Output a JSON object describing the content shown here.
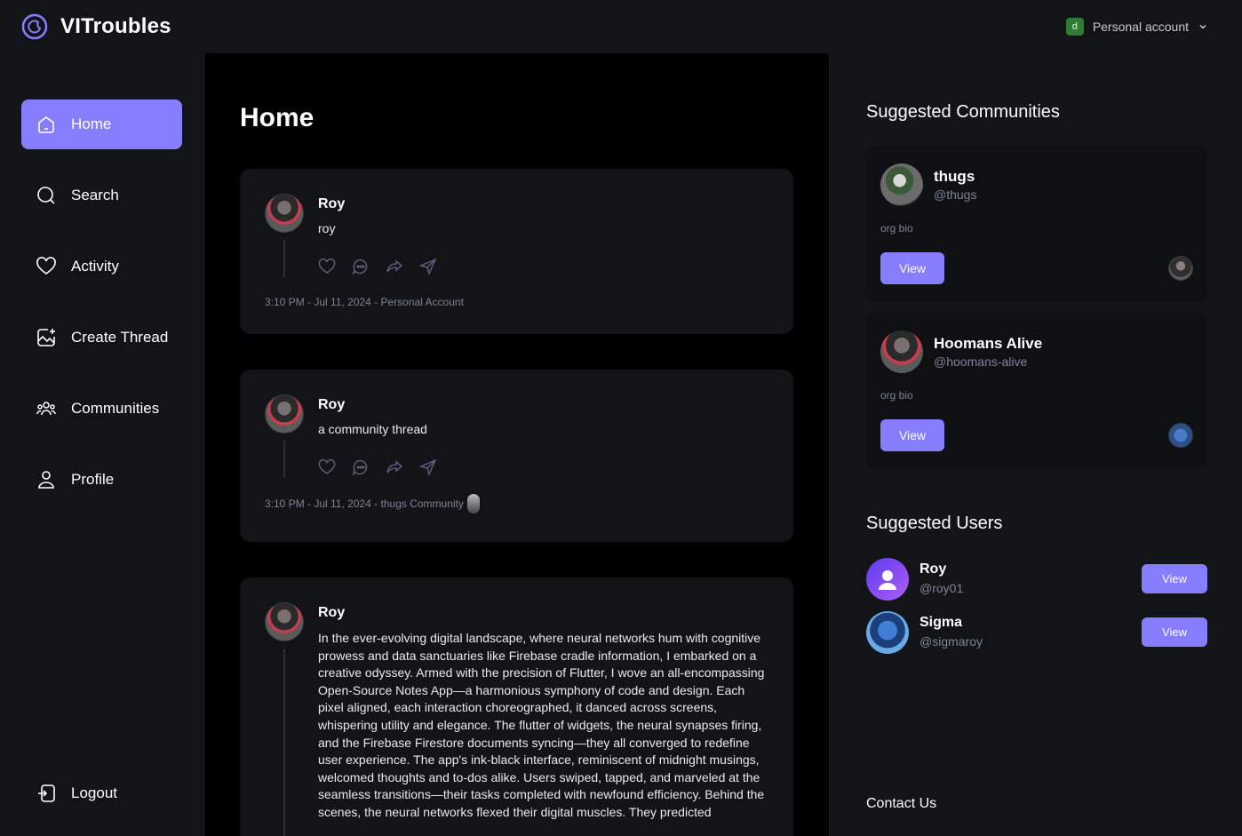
{
  "topbar": {
    "brand": "VITroubles",
    "account_badge": "d",
    "account_label": "Personal account"
  },
  "nav": {
    "items": [
      {
        "label": "Home",
        "icon": "home-icon",
        "active": true
      },
      {
        "label": "Search",
        "icon": "search-icon",
        "active": false
      },
      {
        "label": "Activity",
        "icon": "heart-icon",
        "active": false
      },
      {
        "label": "Create Thread",
        "icon": "create-thread-icon",
        "active": false
      },
      {
        "label": "Communities",
        "icon": "communities-icon",
        "active": false
      },
      {
        "label": "Profile",
        "icon": "user-icon",
        "active": false
      }
    ],
    "logout": "Logout"
  },
  "main": {
    "title": "Home",
    "threads": [
      {
        "author": "Roy",
        "content": "roy",
        "meta": "3:10 PM - Jul 11, 2024 - Personal Account"
      },
      {
        "author": "Roy",
        "content": "a community thread",
        "meta": "3:10 PM - Jul 11, 2024 - thugs Community"
      },
      {
        "author": "Roy",
        "content": "In the ever-evolving digital landscape, where neural networks hum with cognitive prowess and data sanctuaries like Firebase cradle information, I embarked on a creative odyssey. Armed with the precision of Flutter, I wove an all-encompassing Open-Source Notes App—a harmonious symphony of code and design. Each pixel aligned, each interaction choreographed, it danced across screens, whispering utility and elegance. The flutter of widgets, the neural synapses firing, and the Firebase Firestore documents syncing—they all converged to redefine user experience. The app's ink-black interface, reminiscent of midnight musings, welcomed thoughts and to-dos alike. Users swiped, tapped, and marveled at the seamless transitions—their tasks completed with newfound efficiency. Behind the scenes, the neural networks flexed their digital muscles. They predicted"
      }
    ]
  },
  "right": {
    "communities_title": "Suggested Communities",
    "communities": [
      {
        "name": "thugs",
        "handle": "@thugs",
        "bio": "org bio",
        "button": "View"
      },
      {
        "name": "Hoomans Alive",
        "handle": "@hoomans-alive",
        "bio": "org bio",
        "button": "View"
      }
    ],
    "users_title": "Suggested Users",
    "users": [
      {
        "name": "Roy",
        "handle": "@roy01",
        "button": "View"
      },
      {
        "name": "Sigma",
        "handle": "@sigmaroy",
        "button": "View"
      }
    ],
    "contact": "Contact Us"
  },
  "colors": {
    "accent": "#877eff",
    "panel": "#121417",
    "background": "#000000",
    "muted_text": "#7b8496"
  }
}
